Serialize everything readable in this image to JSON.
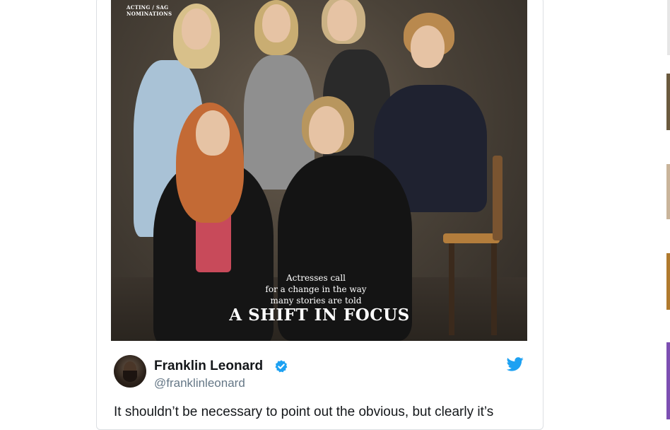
{
  "cover": {
    "tag_line1": "ACTING / SAG",
    "tag_line2": "NOMINATIONS",
    "subtitle_line1": "Actresses call",
    "subtitle_line2": "for a change in the way",
    "subtitle_line3": "many stories are told",
    "headline": "A SHIFT IN FOCUS"
  },
  "tweet": {
    "display_name": "Franklin Leonard",
    "handle": "@franklinleonard",
    "text": "It shouldn’t be necessary to point out the obvious, but clearly it’s",
    "verified": true,
    "icons": {
      "verified": "verified-badge-icon",
      "brand": "twitter-bird-icon"
    }
  },
  "colors": {
    "brand_blue": "#1da1f2",
    "name_text": "#14171a",
    "handle_text": "#657786",
    "card_border": "#dcdfe3"
  }
}
